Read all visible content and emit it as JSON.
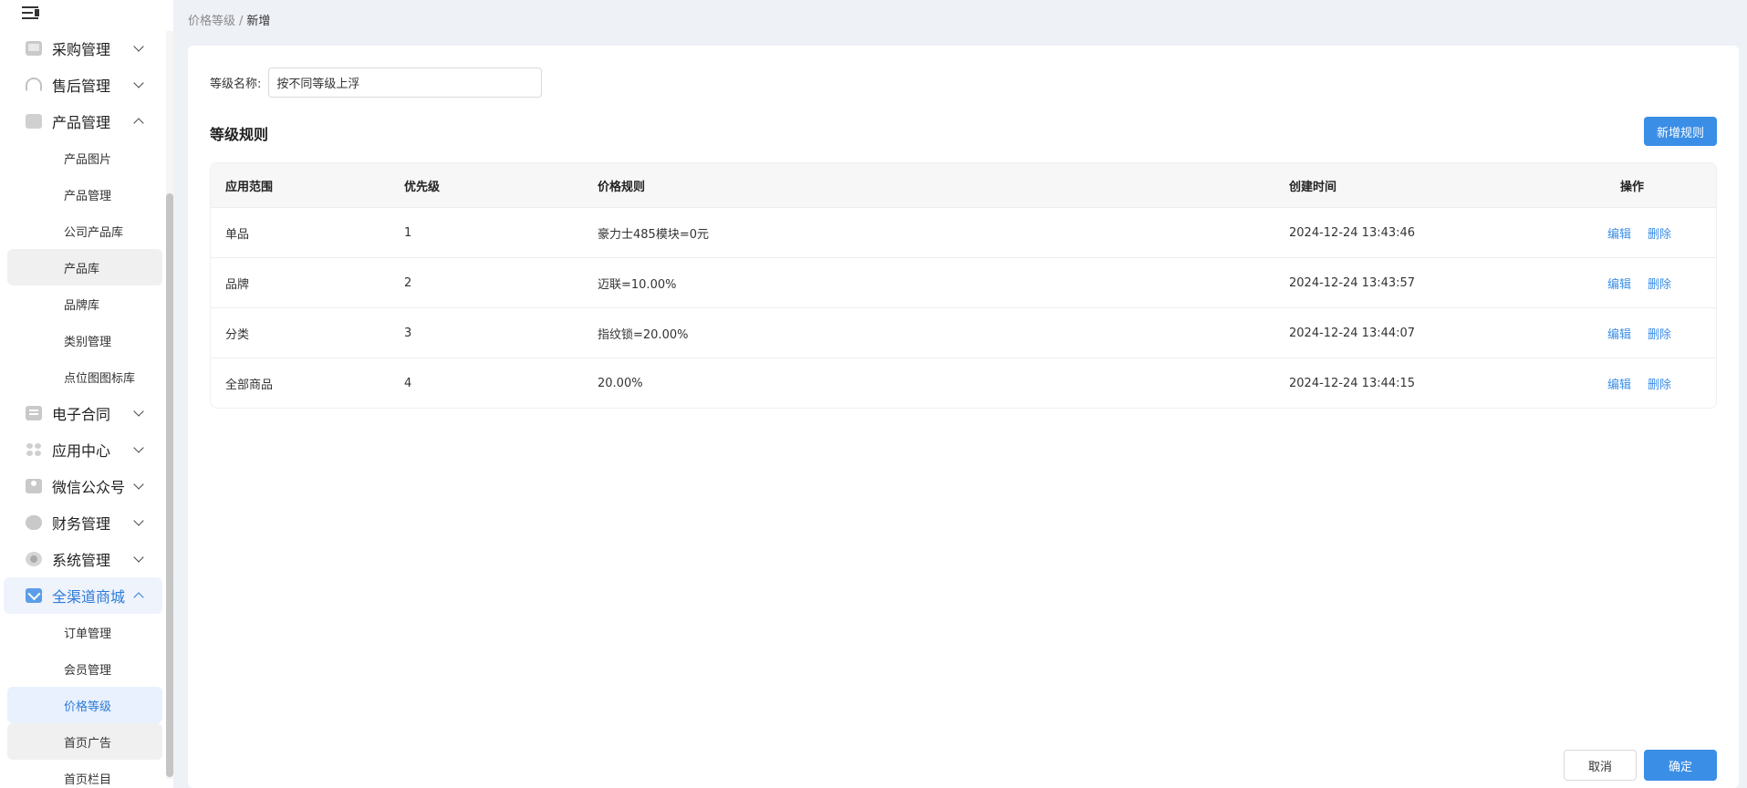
{
  "sidebar": {
    "groups": [
      {
        "label": "采购管理",
        "icon": "cart-icon",
        "expanded": false
      },
      {
        "label": "售后管理",
        "icon": "headset-icon",
        "expanded": false
      },
      {
        "label": "产品管理",
        "icon": "box-icon",
        "expanded": true,
        "children": [
          "产品图片",
          "产品管理",
          "公司产品库",
          "产品库",
          "品牌库",
          "类别管理",
          "点位图图标库"
        ]
      },
      {
        "label": "电子合同",
        "icon": "contract-icon",
        "expanded": false
      },
      {
        "label": "应用中心",
        "icon": "apps-icon",
        "expanded": false
      },
      {
        "label": "微信公众号",
        "icon": "user-icon",
        "expanded": false
      },
      {
        "label": "财务管理",
        "icon": "money-bag-icon",
        "expanded": false
      },
      {
        "label": "系统管理",
        "icon": "gear-icon",
        "expanded": false
      },
      {
        "label": "全渠道商城",
        "icon": "mall-icon",
        "expanded": true,
        "children": [
          "订单管理",
          "会员管理",
          "价格等级",
          "首页广告",
          "首页栏目"
        ]
      }
    ],
    "active_item": "价格等级",
    "accent_color": "#2f7bd8"
  },
  "breadcrumb": {
    "parent": "价格等级",
    "separator": "/",
    "current": "新增"
  },
  "form": {
    "level_name_label": "等级名称:",
    "level_name_value": "按不同等级上浮"
  },
  "rules": {
    "title": "等级规则",
    "add_button": "新增规则",
    "columns": [
      "应用范围",
      "优先级",
      "价格规则",
      "创建时间",
      "操作"
    ],
    "rows": [
      {
        "scope": "单品",
        "priority": "1",
        "rule": "豪力士485模块=0元",
        "created": "2024-12-24 13:43:46",
        "edit": "编辑",
        "delete": "删除"
      },
      {
        "scope": "品牌",
        "priority": "2",
        "rule": "迈联=10.00%",
        "created": "2024-12-24 13:43:57",
        "edit": "编辑",
        "delete": "删除"
      },
      {
        "scope": "分类",
        "priority": "3",
        "rule": "指纹锁=20.00%",
        "created": "2024-12-24 13:44:07",
        "edit": "编辑",
        "delete": "删除"
      },
      {
        "scope": "全部商品",
        "priority": "4",
        "rule": "20.00%",
        "created": "2024-12-24 13:44:15",
        "edit": "编辑",
        "delete": "删除"
      }
    ]
  },
  "footer": {
    "cancel": "取消",
    "confirm": "确定"
  }
}
